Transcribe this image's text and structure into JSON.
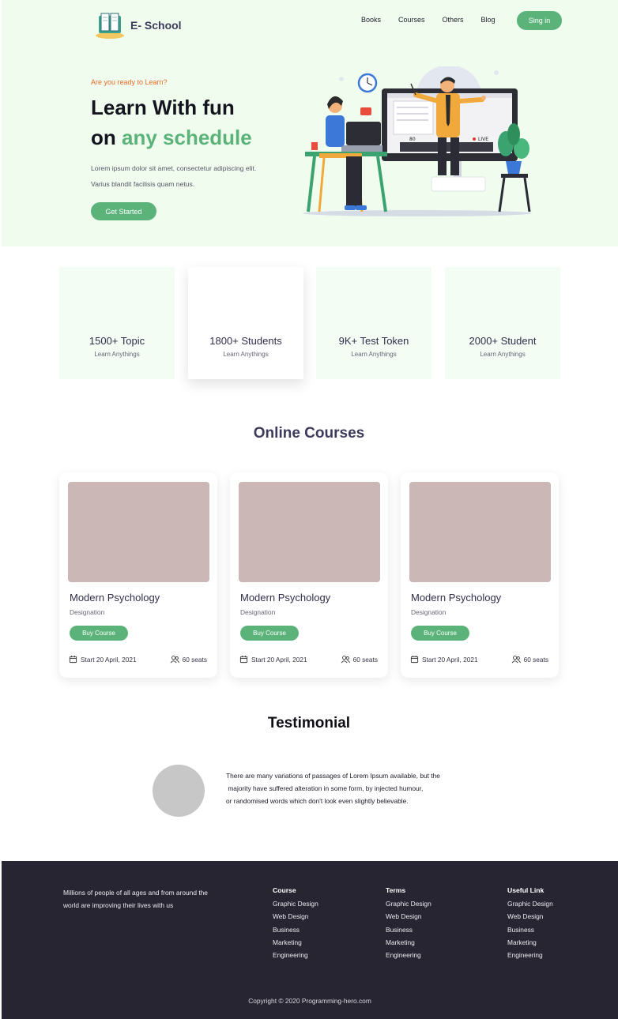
{
  "brand": {
    "name": "E- School"
  },
  "nav": {
    "items": [
      "Books",
      "Courses",
      "Others",
      "Blog"
    ],
    "signin_label": "Sing in"
  },
  "hero": {
    "eyebrow": "Are you ready to Learn?",
    "title_line1": "Learn With fun",
    "title_line2_prefix": "on ",
    "title_line2_accent": "any schedule",
    "description": "Lorem ipsum dolor sit amet, consectetur adipiscing elit. Varius blandit facilisis quam netus.",
    "cta_label": "Get Started",
    "screen_viewers": "80",
    "screen_live": "LIVE"
  },
  "stats": [
    {
      "value": "1500+ Topic",
      "label": "Learn Anythings"
    },
    {
      "value": "1800+ Students",
      "label": "Learn Anythings"
    },
    {
      "value": "9K+ Test Token",
      "label": "Learn Anythings"
    },
    {
      "value": "2000+ Student",
      "label": "Learn Anythings"
    }
  ],
  "courses": {
    "title": "Online Courses",
    "items": [
      {
        "title": "Modern Psychology",
        "designation": "Designation",
        "cta": "Buy Course",
        "start": "Start 20  April, 2021",
        "seats": "60 seats"
      },
      {
        "title": "Modern Psychology",
        "designation": "Designation",
        "cta": "Buy Course",
        "start": "Start 20  April, 2021",
        "seats": "60 seats"
      },
      {
        "title": "Modern Psychology",
        "designation": "Designation",
        "cta": "Buy Course",
        "start": "Start 20  April, 2021",
        "seats": "60 seats"
      }
    ]
  },
  "testimonial": {
    "title": "Testimonial",
    "lines": [
      "There are many variations of passages of Lorem Ipsum available, but the",
      " majority have suffered alteration in some form, by injected humour,",
      "or randomised words which don't look even slightly believable."
    ]
  },
  "footer": {
    "about": "Millions of people of all ages and from around the world are improving their lives with us",
    "columns": [
      {
        "heading": "Course",
        "links": [
          "Graphic Design",
          "Web Design",
          "Business",
          "Marketing",
          "Engineering"
        ]
      },
      {
        "heading": "Terms",
        "links": [
          "Graphic Design",
          "Web Design",
          "Business",
          "Marketing",
          "Engineering"
        ]
      },
      {
        "heading": "Useful Link",
        "links": [
          "Graphic Design",
          "Web Design",
          "Business",
          "Marketing",
          "Engineering"
        ]
      }
    ],
    "copyright": "Copyright © 2020 Programming-hero.com"
  },
  "colors": {
    "accent_green": "#5bb37a",
    "hero_bg": "#f0fdee",
    "eyebrow_orange": "#e86b2a",
    "heading_navy": "#3d3b5b",
    "footer_bg": "#262531",
    "card_image": "#cbb8b6"
  },
  "icons": [
    "book-logo-icon",
    "calendar-icon",
    "users-icon"
  ]
}
